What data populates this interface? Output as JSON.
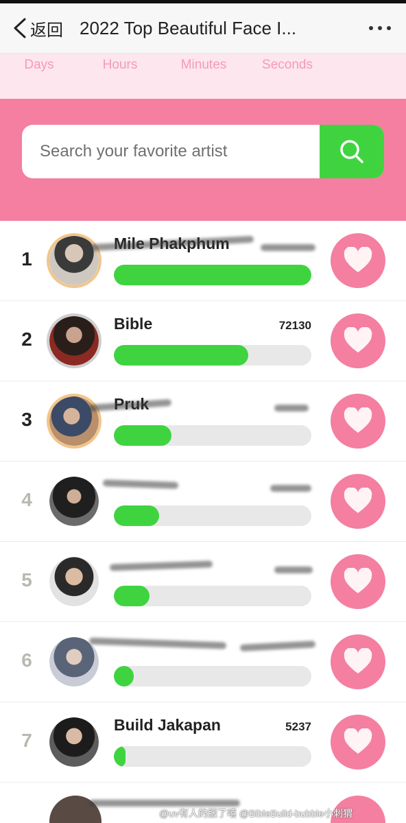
{
  "nav": {
    "back_label": "返回",
    "title": "2022 Top Beautiful Face I...",
    "more_icon": "more-dots-icon"
  },
  "countdown": {
    "labels": [
      "Days",
      "Hours",
      "Minutes",
      "Seconds"
    ]
  },
  "search": {
    "placeholder": "Search your favorite artist",
    "icon": "search-icon"
  },
  "colors": {
    "pink": "#f47fa0",
    "light_pink": "#fde6ee",
    "green": "#3fd43f",
    "bar_track": "#e8e8e8"
  },
  "ranking": [
    {
      "rank": "1",
      "name": "Mile Phakphum",
      "votes": "",
      "progress": 1.0,
      "avatar": "gold"
    },
    {
      "rank": "2",
      "name": "Bible",
      "votes": "72130",
      "progress": 0.68,
      "avatar": "silver"
    },
    {
      "rank": "3",
      "name": "Pruk",
      "votes": "",
      "progress": 0.29,
      "avatar": "gold"
    },
    {
      "rank": "4",
      "name": "",
      "votes": "",
      "progress": 0.23,
      "avatar": "plain"
    },
    {
      "rank": "5",
      "name": "",
      "votes": "",
      "progress": 0.18,
      "avatar": "plain"
    },
    {
      "rank": "6",
      "name": "",
      "votes": "",
      "progress": 0.1,
      "avatar": "plain"
    },
    {
      "rank": "7",
      "name": "Build Jakapan",
      "votes": "5237",
      "progress": 0.06,
      "avatar": "plain"
    }
  ],
  "watermark": "@uv有人的服了嘻 @BibleBuild-bubble小刺猬"
}
